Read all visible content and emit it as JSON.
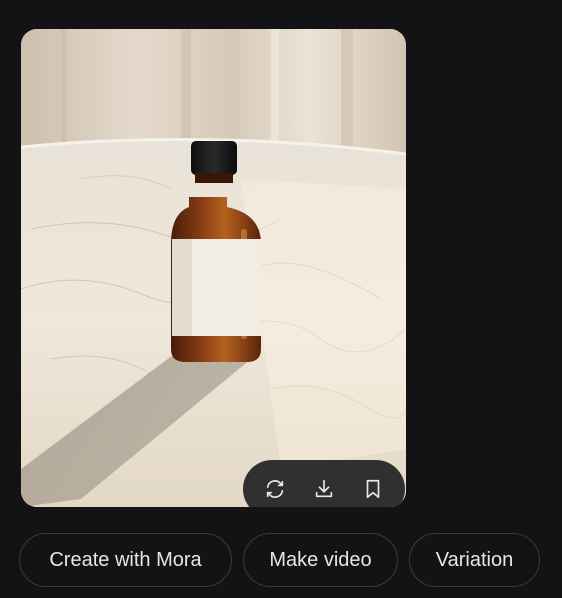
{
  "image": {
    "alt_subject": "amber-bottle-on-marble-table",
    "colors": {
      "bottle_glass": "#6b2e10",
      "bottle_cap": "#1c1c1e",
      "label": "#f1ede4",
      "marble": "#e9e2d6",
      "curtain": "#d9cdbd"
    }
  },
  "image_toolbar": {
    "icons": [
      "refresh-icon",
      "download-icon",
      "bookmark-icon"
    ]
  },
  "actions": {
    "create_label": "Create with Mora",
    "video_label": "Make video",
    "variation_label": "Variation"
  },
  "theme": {
    "background": "#131316",
    "chip_border": "#3a3a3f",
    "chip_text": "#e6e6e8"
  }
}
